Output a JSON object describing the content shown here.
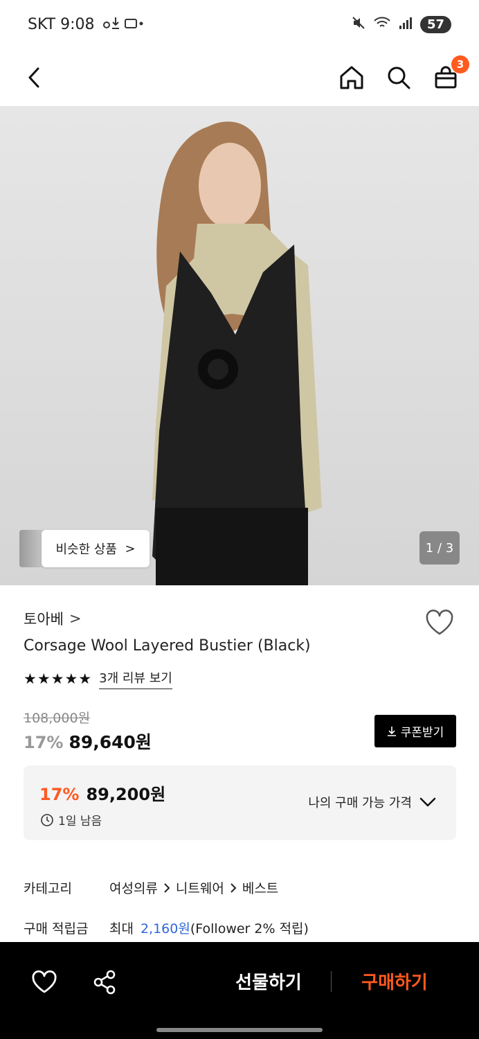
{
  "status_bar": {
    "carrier_time": "SKT 9:08",
    "battery": "57"
  },
  "header": {
    "cart_count": "3"
  },
  "hero": {
    "similar_label": "비슷한 상품",
    "similar_chevron": ">",
    "pager": "1 / 3"
  },
  "product": {
    "brand": "토아베",
    "brand_chevron": ">",
    "name": "Corsage Wool Layered Bustier (Black)",
    "stars": "★★★★★",
    "rating": 4.5,
    "review_link": "3개 리뷰 보기",
    "original_price": "108,000원",
    "discount": "17%",
    "price": "89,640원",
    "coupon_label": "쿠폰받기"
  },
  "my_price": {
    "discount": "17%",
    "price": "89,200원",
    "remaining": "1일 남음",
    "label": "나의 구매 가능 가격"
  },
  "details": {
    "category_key": "카테고리",
    "category_path": [
      "여성의류",
      "니트웨어",
      "베스트"
    ],
    "points_key": "구매 적립금",
    "points_prefix": "최대",
    "points_value": "2,160원",
    "points_suffix": "(Follower 2% 적립)"
  },
  "bottom": {
    "gift_label": "선물하기",
    "buy_label": "구매하기"
  },
  "colors": {
    "accent": "#ff5a1f",
    "link_blue": "#2f67d8"
  }
}
